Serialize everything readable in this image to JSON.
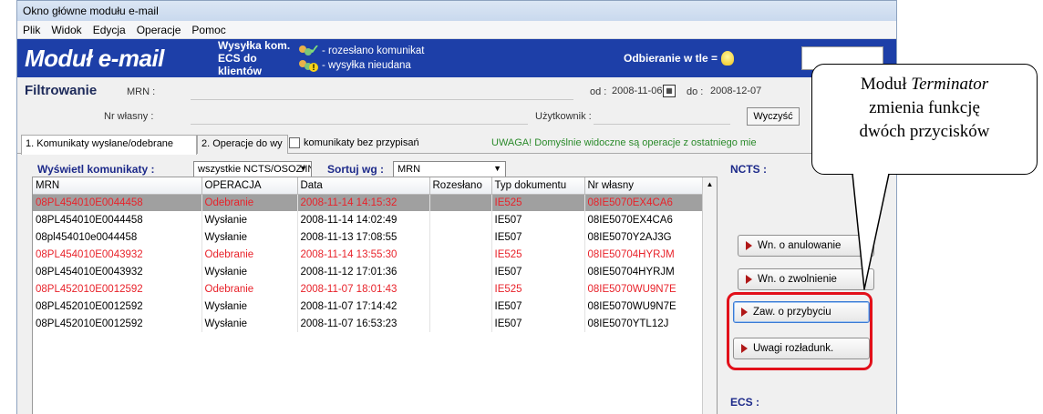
{
  "window": {
    "title": "Okno główne modułu e-mail"
  },
  "menu": [
    "Plik",
    "Widok",
    "Edycja",
    "Operacje",
    "Pomoc"
  ],
  "banner": {
    "logo": "Moduł e-mail",
    "send_line1": "Wysyłka kom.",
    "send_line2": "ECS do klientów",
    "legend_sent": "- rozesłano komunikat",
    "legend_failed": "- wysyłka nieudana",
    "background_receive": "Odbieranie w tle ="
  },
  "filter": {
    "title": "Filtrowanie",
    "mrn_label": "MRN :",
    "own_no_label": "Nr własny :",
    "from_label": "od :",
    "from_value": "2008-11-06",
    "to_label": "do :",
    "to_value": "2008-12-07",
    "user_label": "Użytkownik :",
    "clear_button": "Wyczyść"
  },
  "tabs": [
    "1. Komunikaty wysłane/odebrane",
    "2. Operacje do wy"
  ],
  "unassigned_checkbox": "komunikaty bez przypisań",
  "notice": "UWAGA! Domyślnie widoczne są operacje z ostatniego mie",
  "controls": {
    "show_label": "Wyświetl komunikaty :",
    "show_value": "wszystkie NCTS/OSOZ/INF(",
    "sort_label": "Sortuj wg :",
    "sort_value": "MRN"
  },
  "table": {
    "columns": [
      "MRN",
      "OPERACJA",
      "Data",
      "Rozesłano",
      "Typ dokumentu",
      "Nr własny"
    ],
    "rows": [
      {
        "mrn": "08PL454010E0044458",
        "op": "Odebranie",
        "date": "2008-11-14 14:15:32",
        "sent": "",
        "type": "IE525",
        "own": "08IE5070EX4CA6",
        "style": "selected"
      },
      {
        "mrn": "08PL454010E0044458",
        "op": "Wysłanie",
        "date": "2008-11-14 14:02:49",
        "sent": "",
        "type": "IE507",
        "own": "08IE5070EX4CA6",
        "style": "normal"
      },
      {
        "mrn": "08pl454010e0044458",
        "op": "Wysłanie",
        "date": "2008-11-13 17:08:55",
        "sent": "",
        "type": "IE507",
        "own": "08IE5070Y2AJ3G",
        "style": "normal"
      },
      {
        "mrn": "08PL454010E0043932",
        "op": "Odebranie",
        "date": "2008-11-14 13:55:30",
        "sent": "",
        "type": "IE525",
        "own": "08IE50704HYRJM",
        "style": "red"
      },
      {
        "mrn": "08PL454010E0043932",
        "op": "Wysłanie",
        "date": "2008-11-12 17:01:36",
        "sent": "",
        "type": "IE507",
        "own": "08IE50704HYRJM",
        "style": "normal"
      },
      {
        "mrn": "08PL452010E0012592",
        "op": "Odebranie",
        "date": "2008-11-07 18:01:43",
        "sent": "",
        "type": "IE525",
        "own": "08IE5070WU9N7E",
        "style": "red"
      },
      {
        "mrn": "08PL452010E0012592",
        "op": "Wysłanie",
        "date": "2008-11-07 17:14:42",
        "sent": "",
        "type": "IE507",
        "own": "08IE5070WU9N7E",
        "style": "normal"
      },
      {
        "mrn": "08PL452010E0012592",
        "op": "Wysłanie",
        "date": "2008-11-07 16:53:23",
        "sent": "",
        "type": "IE507",
        "own": "08IE5070YTL12J",
        "style": "normal"
      }
    ]
  },
  "side": {
    "ncts_label": "NCTS :",
    "ecs_label": "ECS :",
    "buttons": [
      "Wn. o anulowanie",
      "Wn. o zwolnienie",
      "Zaw. o przybyciu",
      "Uwagi rozładunk."
    ]
  },
  "callout": {
    "line1_prefix": "Moduł ",
    "line1_italic": "Terminator",
    "line2": "zmienia funkcję",
    "line3": "dwóch przycisków"
  },
  "colors": {
    "banner": "#1d3fa8",
    "highlight": "#e2101a",
    "red_text": "#e8222a"
  }
}
